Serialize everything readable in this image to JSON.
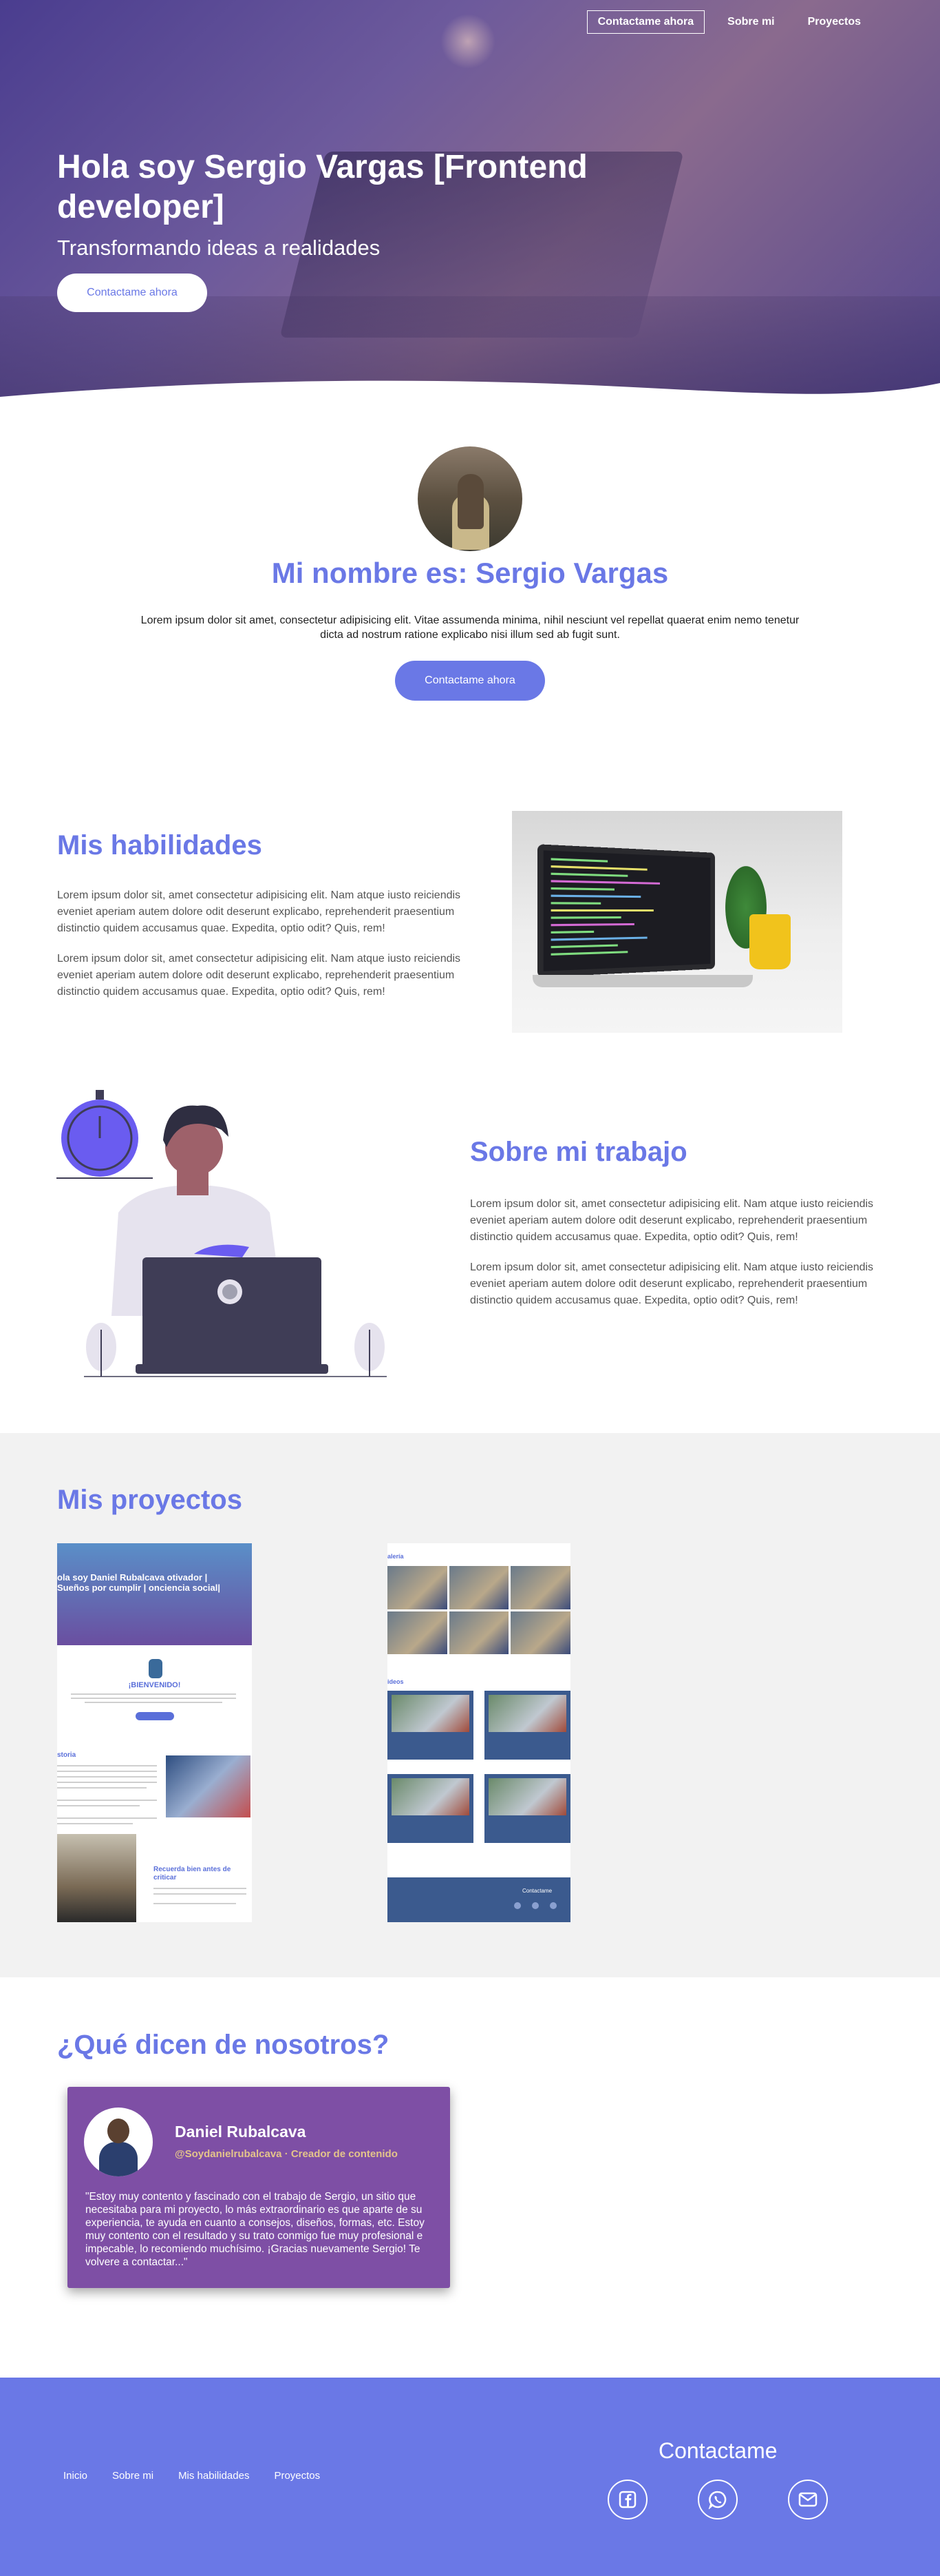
{
  "nav": {
    "items": [
      "Contactame ahora",
      "Sobre mi",
      "Proyectos"
    ]
  },
  "hero": {
    "title": "Hola soy Sergio Vargas [Frontend developer]",
    "subtitle": "Transformando ideas a realidades",
    "button": "Contactame ahora"
  },
  "about": {
    "title": "Mi nombre es: Sergio Vargas",
    "text": "Lorem ipsum dolor sit amet, consectetur adipisicing elit. Vitae assumenda minima, nihil nesciunt vel repellat quaerat enim nemo tenetur dicta ad nostrum ratione explicabo nisi illum sed ab fugit sunt.",
    "button": "Contactame ahora"
  },
  "skills": {
    "title": "Mis habilidades",
    "paragraphs": [
      "Lorem ipsum dolor sit, amet consectetur adipisicing elit. Nam atque iusto reiciendis eveniet aperiam autem dolore odit deserunt explicabo, reprehenderit praesentium distinctio quidem accusamus quae. Expedita, optio odit? Quis, rem!",
      "Lorem ipsum dolor sit, amet consectetur adipisicing elit. Nam atque iusto reiciendis eveniet aperiam autem dolore odit deserunt explicabo, reprehenderit praesentium distinctio quidem accusamus quae. Expedita, optio odit? Quis, rem!"
    ]
  },
  "work": {
    "title": "Sobre mi trabajo",
    "paragraphs": [
      "Lorem ipsum dolor sit, amet consectetur adipisicing elit. Nam atque iusto reiciendis eveniet aperiam autem dolore odit deserunt explicabo, reprehenderit praesentium distinctio quidem accusamus quae. Expedita, optio odit? Quis, rem!",
      "Lorem ipsum dolor sit, amet consectetur adipisicing elit. Nam atque iusto reiciendis eveniet aperiam autem dolore odit deserunt explicabo, reprehenderit praesentium distinctio quidem accusamus quae. Expedita, optio odit? Quis, rem!"
    ]
  },
  "projects": {
    "title": "Mis proyectos",
    "shot1": {
      "header": "ola soy Daniel Rubalcava otivador | Sueños por cumplir | onciencia social|",
      "welcome": "¡BIENVENIDO!",
      "history": "storia",
      "reminder": "Recuerda bien antes de criticar"
    },
    "shot2": {
      "gallery": "alería",
      "videos": "ideos",
      "footer": "Contactame"
    }
  },
  "testimonials": {
    "title": "¿Qué dicen de nosotros?",
    "card": {
      "name": "Daniel Rubalcava",
      "handle": "@Soydanielrubalcava · Creador de contenido",
      "quote": "\"Estoy muy contento y fascinado con el trabajo de Sergio, un sitio que necesitaba para mi proyecto, lo más extraordinario es que aparte de su experiencia, te ayuda en cuanto a consejos, diseños, formas, etc. Estoy muy contento con el resultado y su trato conmigo fue muy profesional e impecable, lo recomiendo muchísimo. ¡Gracias nuevamente Sergio! Te volvere a contactar...\""
    }
  },
  "footer": {
    "links": [
      "Inicio",
      "Sobre mi",
      "Mis habilidades",
      "Proyectos"
    ],
    "contact_title": "Contactame",
    "socials": [
      "facebook-icon",
      "whatsapp-icon",
      "mail-icon"
    ]
  },
  "colors": {
    "accent": "#6a78e6",
    "card": "#7e4fa5",
    "handle": "#e4c48a"
  }
}
